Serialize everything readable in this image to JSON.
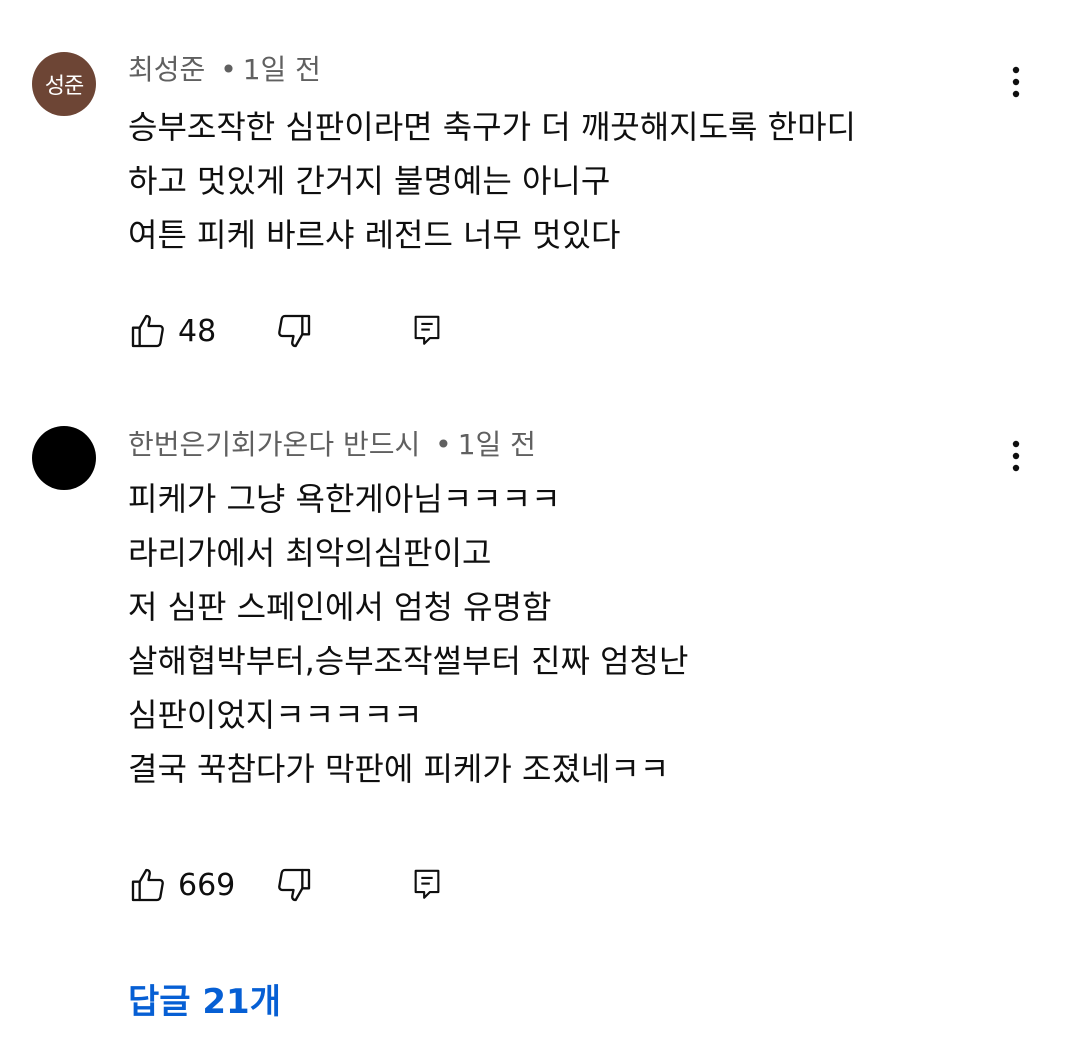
{
  "comments": [
    {
      "avatar_text": "성준",
      "avatar_color": "#6d4535",
      "author": "최성준",
      "separator": "•",
      "time": "1일 전",
      "lines": [
        "승부조작한 심판이라면 축구가 더 깨끗해지도록 한마디",
        "하고 멋있게 간거지 불명예는 아니구",
        "여튼 피케 바르샤 레전드 너무 멋있다"
      ],
      "likes": "48",
      "icons": [
        "thumbs-up-icon",
        "thumbs-down-icon",
        "reply-icon",
        "more-vert-icon"
      ]
    },
    {
      "avatar_text": "",
      "avatar_color": "#000000",
      "author": "한번은기회가온다 반드시",
      "separator": "•",
      "time": "1일 전",
      "lines": [
        "피케가 그냥 욕한게아님ㅋㅋㅋㅋ",
        "라리가에서 최악의심판이고",
        "저 심판 스페인에서 엄청 유명함",
        "살해협박부터,승부조작썰부터 진짜 엄청난",
        "심판이었지ㅋㅋㅋㅋㅋ",
        "결국 꾹참다가 막판에 피케가 조졌네ㅋㅋ"
      ],
      "likes": "669",
      "icons": [
        "thumbs-up-icon",
        "thumbs-down-icon",
        "reply-icon",
        "more-vert-icon"
      ]
    }
  ],
  "replies_label": "답글 21개",
  "colors": {
    "text_primary": "#0f0f0f",
    "text_secondary": "#606060",
    "link": "#065fd4"
  }
}
